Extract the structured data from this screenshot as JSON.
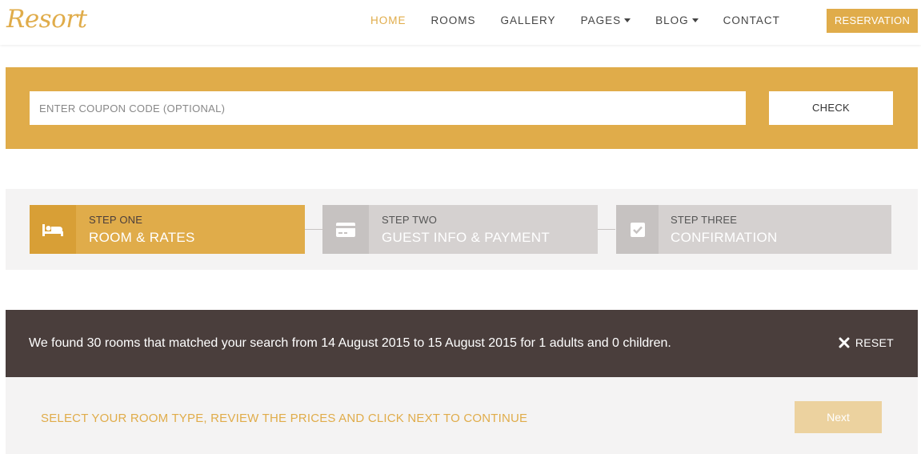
{
  "brand": {
    "logo_text": "Resort",
    "accent_color": "#e0ac4a",
    "dark_color": "#4a3e3c"
  },
  "nav": {
    "items": [
      {
        "label": "HOME",
        "active": true,
        "dropdown": false
      },
      {
        "label": "ROOMS",
        "active": false,
        "dropdown": false
      },
      {
        "label": "GALLERY",
        "active": false,
        "dropdown": false
      },
      {
        "label": "PAGES",
        "active": false,
        "dropdown": true
      },
      {
        "label": "BLOG",
        "active": false,
        "dropdown": true
      },
      {
        "label": "CONTACT",
        "active": false,
        "dropdown": false
      }
    ],
    "reservation_label": "RESERVATION"
  },
  "coupon": {
    "placeholder": "ENTER COUPON CODE (OPTIONAL)",
    "value": "",
    "check_label": "CHECK"
  },
  "steps": [
    {
      "small": "STEP ONE",
      "big": "ROOM & RATES",
      "icon": "bed-icon",
      "active": true
    },
    {
      "small": "STEP TWO",
      "big": "GUEST INFO & PAYMENT",
      "icon": "credit-card-icon",
      "active": false
    },
    {
      "small": "STEP THREE",
      "big": "CONFIRMATION",
      "icon": "checkbox-icon",
      "active": false
    }
  ],
  "result": {
    "message": "We found 30 rooms that matched your search from 14 August 2015 to 15 August 2015 for 1 adults and 0 children.",
    "reset_label": "RESET",
    "reset_icon": "close-icon"
  },
  "footer": {
    "instruction": "SELECT YOUR ROOM TYPE, REVIEW THE PRICES AND CLICK NEXT TO CONTINUE",
    "next_label": "Next"
  }
}
